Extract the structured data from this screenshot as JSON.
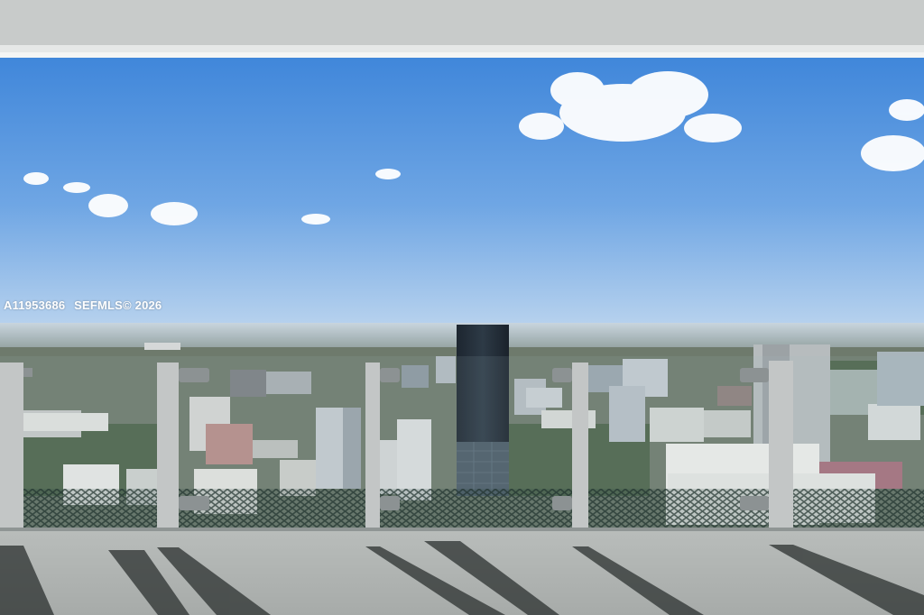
{
  "photo": {
    "listing_id": "A11953686",
    "copyright": "SEFMLS© 2026"
  }
}
